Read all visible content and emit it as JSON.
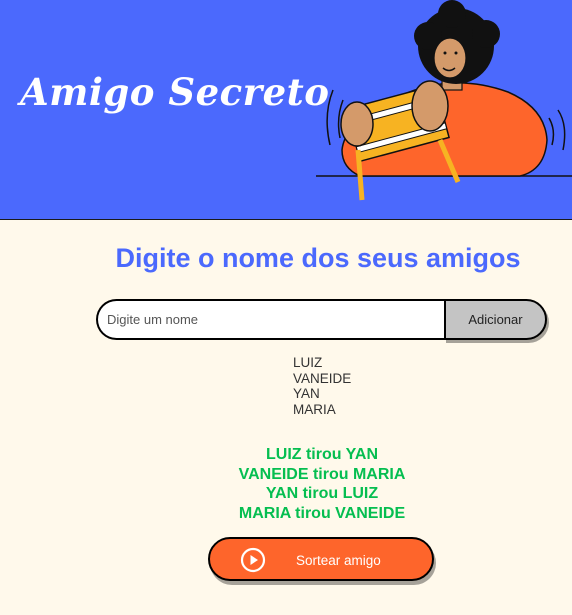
{
  "header": {
    "title": "Amigo Secreto",
    "background_color": "#4b69fd",
    "illustration": "person-holding-gift-box-illustration"
  },
  "main": {
    "subtitle": "Digite o nome dos seus amigos",
    "input": {
      "placeholder": "Digite um nome",
      "value": ""
    },
    "add_button_label": "Adicionar",
    "friends": [
      "LUIZ",
      "VANEIDE",
      "YAN",
      "MARIA"
    ],
    "results": [
      "LUIZ tirou YAN",
      "VANEIDE tirou MARIA",
      "YAN tirou LUIZ",
      "MARIA tirou VANEIDE"
    ],
    "draw_button": {
      "label": "Sortear amigo",
      "icon": "play-circle-icon"
    }
  },
  "colors": {
    "accent": "#4b69fd",
    "page_background": "#fff9eb",
    "draw_button": "#fe652b",
    "result_text": "#05be50",
    "add_button": "#c4c4c4"
  }
}
